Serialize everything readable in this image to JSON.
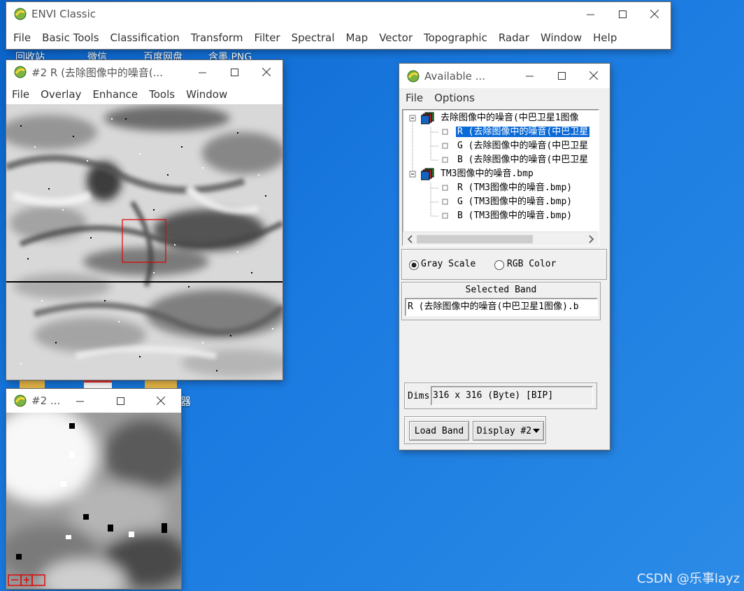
{
  "desktop": {
    "icon_labels": [
      "回收站",
      "微信",
      "百度网盘",
      "含墨.PNG"
    ],
    "partial_label": "器",
    "watermark": "CSDN @乐事layz"
  },
  "envi": {
    "title": "ENVI Classic",
    "menu": [
      "File",
      "Basic Tools",
      "Classification",
      "Transform",
      "Filter",
      "Spectral",
      "Map",
      "Vector",
      "Topographic",
      "Radar",
      "Window",
      "Help"
    ]
  },
  "image_window": {
    "title": "#2 R (去除图像中的噪音(...",
    "menu": [
      "File",
      "Overlay",
      "Enhance",
      "Tools",
      "Window"
    ]
  },
  "zoom_window": {
    "title": "#2 ..."
  },
  "bands": {
    "title": "Available ...",
    "menu": [
      "File",
      "Options"
    ],
    "tree": [
      {
        "label": "去除图像中的噪音(中巴卫星1图像",
        "children": [
          "R (去除图像中的噪音(中巴卫星",
          "G (去除图像中的噪音(中巴卫星",
          "B (去除图像中的噪音(中巴卫星"
        ]
      },
      {
        "label": "TM3图像中的噪音.bmp",
        "children": [
          "R (TM3图像中的噪音.bmp)",
          "G (TM3图像中的噪音.bmp)",
          "B (TM3图像中的噪音.bmp)"
        ]
      }
    ],
    "gray_scale_label": "Gray Scale",
    "rgb_color_label": "RGB Color",
    "selected_band_label": "Selected Band",
    "selected_band_value": "R (去除图像中的噪音(中巴卫星1图像).b",
    "dims_label": "Dims",
    "dims_value": "316 x 316 (Byte) [BIP]",
    "load_band_label": "Load Band",
    "display_label": "Display #2"
  }
}
